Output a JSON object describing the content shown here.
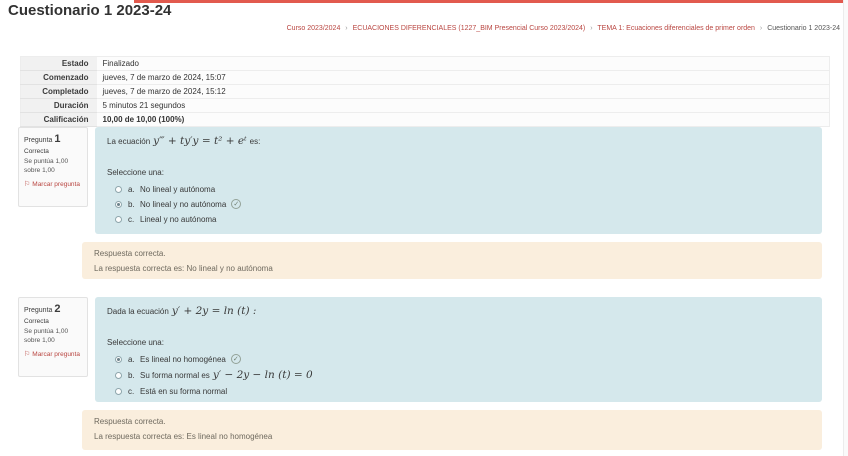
{
  "page": {
    "title": "Cuestionario 1 2023-24"
  },
  "breadcrumb": {
    "separator": "›",
    "items": [
      "Curso 2023/2024",
      "ECUACIONES DIFERENCIALES (1227_BIM Presencial Curso 2023/2024)",
      "TEMA 1: Ecuaciones diferenciales de primer orden",
      "Cuestionario 1 2023-24"
    ]
  },
  "summary": {
    "rows": [
      {
        "label": "Estado",
        "value": "Finalizado"
      },
      {
        "label": "Comenzado",
        "value": "jueves, 7 de marzo de 2024, 15:07"
      },
      {
        "label": "Completado",
        "value": "jueves, 7 de marzo de 2024, 15:12"
      },
      {
        "label": "Duración",
        "value": "5 minutos 21 segundos"
      },
      {
        "label": "Calificación",
        "value": "10,00 de 10,00 (100%)"
      }
    ]
  },
  "icons": {
    "check": "✓",
    "flag": "⚐"
  },
  "colors": {
    "accent_red": "#e25a4e",
    "link_red": "#b94641",
    "question_bg": "#d5e8ec",
    "feedback_bg": "#faeedd"
  },
  "questions": [
    {
      "label": "Pregunta",
      "number": "1",
      "status": "Correcta",
      "points": "Se puntúa 1,00 sobre 1,00",
      "flag_label": "Marcar pregunta",
      "prompt_prefix": "La ecuación",
      "math": "y‴ + ty′y = t² + eᵗ",
      "prompt_suffix": "es:",
      "select_label": "Seleccione una:",
      "options": [
        {
          "letter": "a.",
          "text": "No lineal y autónoma"
        },
        {
          "letter": "b.",
          "text": "No lineal y no autónoma"
        },
        {
          "letter": "c.",
          "text": "Lineal y no autónoma"
        }
      ],
      "feedback_title": "Respuesta correcta.",
      "feedback_text": "La respuesta correcta es: No lineal y no autónoma"
    },
    {
      "label": "Pregunta",
      "number": "2",
      "status": "Correcta",
      "points": "Se puntúa 1,00 sobre 1,00",
      "flag_label": "Marcar pregunta",
      "prompt_prefix": "Dada la ecuación",
      "math": "y′ + 2y = ln (t) :",
      "prompt_suffix": "",
      "select_label": "Seleccione una:",
      "options": [
        {
          "letter": "a.",
          "text": "Es lineal no homogénea"
        },
        {
          "letter": "b.",
          "text": "Su forma normal es",
          "math": "y′ − 2y − ln (t) = 0"
        },
        {
          "letter": "c.",
          "text": "Está en su forma normal"
        }
      ],
      "feedback_title": "Respuesta correcta.",
      "feedback_text": "La respuesta correcta es: Es lineal no homogénea"
    }
  ]
}
